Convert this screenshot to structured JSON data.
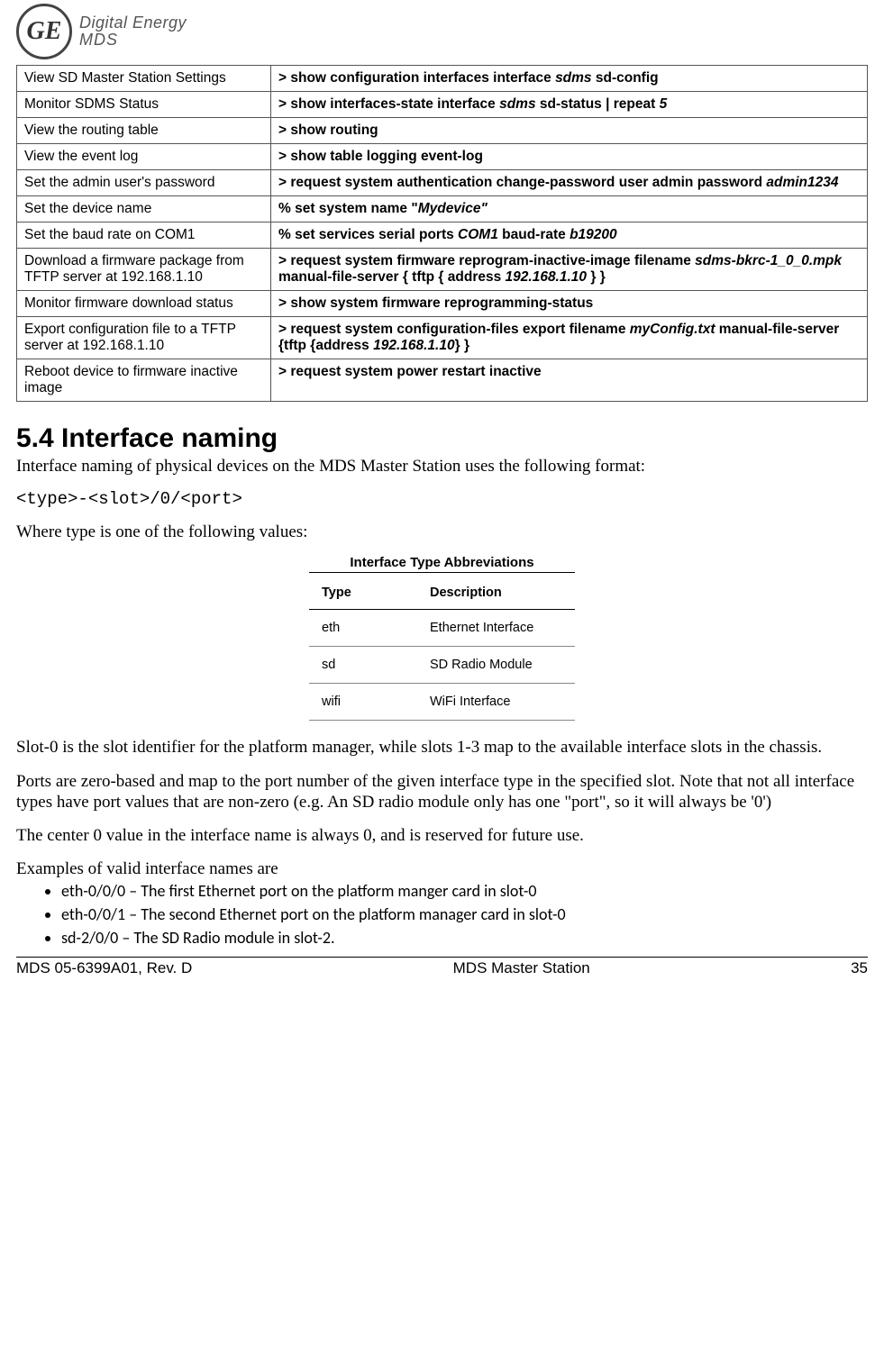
{
  "header": {
    "brand_line1": "Digital Energy",
    "brand_line2": "MDS"
  },
  "cmd_table": [
    {
      "desc": "View SD Master Station Settings",
      "cmd": [
        [
          "> show configuration interfaces interface ",
          false
        ],
        [
          "sdms",
          true
        ],
        [
          " sd-config",
          false
        ]
      ]
    },
    {
      "desc": "Monitor SDMS Status",
      "cmd": [
        [
          "> show interfaces-state interface ",
          false
        ],
        [
          "sdms",
          true
        ],
        [
          " sd-status | repeat ",
          false
        ],
        [
          "5",
          true
        ]
      ]
    },
    {
      "desc": "View the routing table",
      "cmd": [
        [
          "> show routing",
          false
        ]
      ]
    },
    {
      "desc": "View the event log",
      "cmd": [
        [
          "> show table logging event-log",
          false
        ]
      ]
    },
    {
      "desc": "Set the admin user's password",
      "cmd": [
        [
          "> request system authentication change-password user admin password ",
          false
        ],
        [
          "admin1234",
          true
        ]
      ]
    },
    {
      "desc": "Set the device name",
      "cmd": [
        [
          "% set system name \"",
          false
        ],
        [
          "Mydevice\"",
          true
        ]
      ]
    },
    {
      "desc": "Set the baud rate on COM1",
      "cmd": [
        [
          "% set services serial ports ",
          false
        ],
        [
          "COM1",
          true
        ],
        [
          " baud-rate ",
          false
        ],
        [
          "b19200",
          true
        ]
      ]
    },
    {
      "desc": "Download a firmware package from TFTP server at 192.168.1.10",
      "cmd": [
        [
          "> request system firmware reprogram-inactive-image filename ",
          false
        ],
        [
          "sdms-bkrc-1_0_0.mpk",
          true
        ],
        [
          " manual-file-server { tftp { address ",
          false
        ],
        [
          "192.168.1.10",
          true
        ],
        [
          " } }",
          false
        ]
      ]
    },
    {
      "desc": "Monitor firmware download status",
      "cmd": [
        [
          "> show system firmware reprogramming-status",
          false
        ]
      ]
    },
    {
      "desc": "Export configuration file to a TFTP server at 192.168.1.10",
      "cmd": [
        [
          "> request system configuration-files export filename ",
          false
        ],
        [
          "myConfig.txt",
          true
        ],
        [
          " manual-file-server {tftp {address ",
          false
        ],
        [
          "192.168.1.10",
          true
        ],
        [
          "} }",
          false
        ]
      ]
    },
    {
      "desc": "Reboot device to firmware inactive image",
      "cmd": [
        [
          "> request system power restart inactive",
          false
        ]
      ]
    }
  ],
  "section_heading": "5.4 Interface naming",
  "para1": "Interface naming of physical devices on the MDS Master Station uses the following format:",
  "format_line": "<type>-<slot>/0/<port>",
  "para2": "Where type is one of the following values:",
  "abbr_title": "Interface Type Abbreviations",
  "abbr_headers": {
    "type": "Type",
    "desc": "Description"
  },
  "abbr_rows": [
    {
      "type": "eth",
      "desc": "Ethernet Interface"
    },
    {
      "type": "sd",
      "desc": "SD Radio Module"
    },
    {
      "type": "wifi",
      "desc": "WiFi Interface"
    }
  ],
  "para3": "Slot-0 is the slot identifier for the platform manager, while slots 1-3 map to the available interface slots in the chassis.",
  "para4": "Ports are zero-based and map to the port number of the given interface type in the specified slot. Note that not all interface types have port values that are non-zero (e.g. An SD radio module only has one \"port\", so it will always be '0')",
  "para5": "The center 0 value in the interface name is always 0, and is reserved for future use.",
  "para6": "Examples of valid interface names are",
  "examples": [
    "eth-0/0/0 – The first Ethernet port on the platform manger card in slot-0",
    "eth-0/0/1 – The second Ethernet port on the platform manager card in slot-0",
    "sd-2/0/0 – The SD Radio module in slot-2."
  ],
  "footer": {
    "left": "MDS 05-6399A01, Rev. D",
    "center": "MDS Master Station",
    "right": "35"
  }
}
